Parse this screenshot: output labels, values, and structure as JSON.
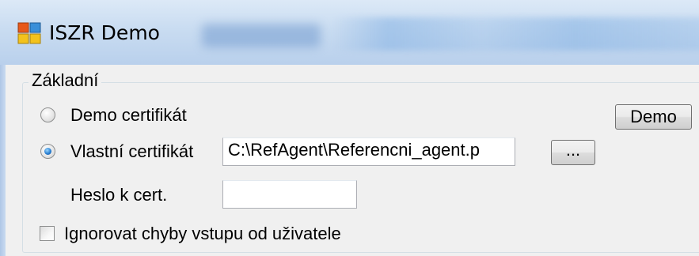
{
  "window": {
    "title": "ISZR Demo"
  },
  "group": {
    "legend": "Základní",
    "radio_demo_label": "Demo certifikát",
    "radio_own_label": "Vlastní certifikát",
    "selected": "own",
    "cert_path_value": "C:\\RefAgent\\Referencni_agent.p",
    "browse_label": "...",
    "password_label": "Heslo k cert.",
    "password_value": "",
    "demo_button_label": "Demo",
    "ignore_checkbox_label": "Ignorovat chyby vstupu od uživatele",
    "ignore_checked": false
  },
  "colors": {
    "title_bar": "#c9dcf1",
    "client_bg": "#f0f0f0",
    "radio_dot": "#2a7fd1"
  }
}
